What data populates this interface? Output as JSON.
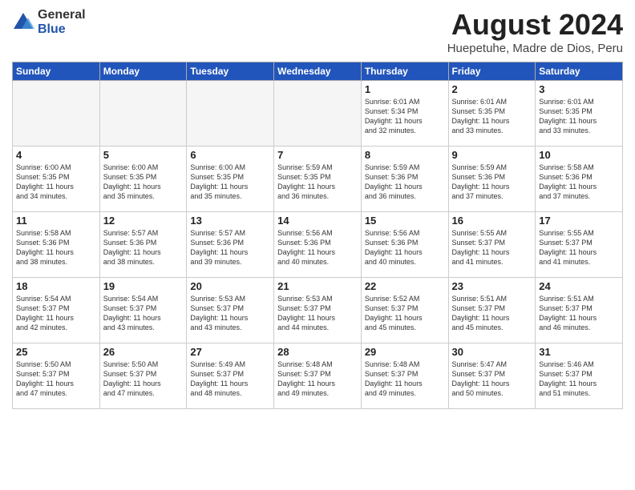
{
  "logo": {
    "general": "General",
    "blue": "Blue"
  },
  "title": "August 2024",
  "subtitle": "Huepetuhe, Madre de Dios, Peru",
  "days_header": [
    "Sunday",
    "Monday",
    "Tuesday",
    "Wednesday",
    "Thursday",
    "Friday",
    "Saturday"
  ],
  "weeks": [
    [
      {
        "day": "",
        "info": ""
      },
      {
        "day": "",
        "info": ""
      },
      {
        "day": "",
        "info": ""
      },
      {
        "day": "",
        "info": ""
      },
      {
        "day": "1",
        "info": "Sunrise: 6:01 AM\nSunset: 5:34 PM\nDaylight: 11 hours\nand 32 minutes."
      },
      {
        "day": "2",
        "info": "Sunrise: 6:01 AM\nSunset: 5:35 PM\nDaylight: 11 hours\nand 33 minutes."
      },
      {
        "day": "3",
        "info": "Sunrise: 6:01 AM\nSunset: 5:35 PM\nDaylight: 11 hours\nand 33 minutes."
      }
    ],
    [
      {
        "day": "4",
        "info": "Sunrise: 6:00 AM\nSunset: 5:35 PM\nDaylight: 11 hours\nand 34 minutes."
      },
      {
        "day": "5",
        "info": "Sunrise: 6:00 AM\nSunset: 5:35 PM\nDaylight: 11 hours\nand 35 minutes."
      },
      {
        "day": "6",
        "info": "Sunrise: 6:00 AM\nSunset: 5:35 PM\nDaylight: 11 hours\nand 35 minutes."
      },
      {
        "day": "7",
        "info": "Sunrise: 5:59 AM\nSunset: 5:35 PM\nDaylight: 11 hours\nand 36 minutes."
      },
      {
        "day": "8",
        "info": "Sunrise: 5:59 AM\nSunset: 5:36 PM\nDaylight: 11 hours\nand 36 minutes."
      },
      {
        "day": "9",
        "info": "Sunrise: 5:59 AM\nSunset: 5:36 PM\nDaylight: 11 hours\nand 37 minutes."
      },
      {
        "day": "10",
        "info": "Sunrise: 5:58 AM\nSunset: 5:36 PM\nDaylight: 11 hours\nand 37 minutes."
      }
    ],
    [
      {
        "day": "11",
        "info": "Sunrise: 5:58 AM\nSunset: 5:36 PM\nDaylight: 11 hours\nand 38 minutes."
      },
      {
        "day": "12",
        "info": "Sunrise: 5:57 AM\nSunset: 5:36 PM\nDaylight: 11 hours\nand 38 minutes."
      },
      {
        "day": "13",
        "info": "Sunrise: 5:57 AM\nSunset: 5:36 PM\nDaylight: 11 hours\nand 39 minutes."
      },
      {
        "day": "14",
        "info": "Sunrise: 5:56 AM\nSunset: 5:36 PM\nDaylight: 11 hours\nand 40 minutes."
      },
      {
        "day": "15",
        "info": "Sunrise: 5:56 AM\nSunset: 5:36 PM\nDaylight: 11 hours\nand 40 minutes."
      },
      {
        "day": "16",
        "info": "Sunrise: 5:55 AM\nSunset: 5:37 PM\nDaylight: 11 hours\nand 41 minutes."
      },
      {
        "day": "17",
        "info": "Sunrise: 5:55 AM\nSunset: 5:37 PM\nDaylight: 11 hours\nand 41 minutes."
      }
    ],
    [
      {
        "day": "18",
        "info": "Sunrise: 5:54 AM\nSunset: 5:37 PM\nDaylight: 11 hours\nand 42 minutes."
      },
      {
        "day": "19",
        "info": "Sunrise: 5:54 AM\nSunset: 5:37 PM\nDaylight: 11 hours\nand 43 minutes."
      },
      {
        "day": "20",
        "info": "Sunrise: 5:53 AM\nSunset: 5:37 PM\nDaylight: 11 hours\nand 43 minutes."
      },
      {
        "day": "21",
        "info": "Sunrise: 5:53 AM\nSunset: 5:37 PM\nDaylight: 11 hours\nand 44 minutes."
      },
      {
        "day": "22",
        "info": "Sunrise: 5:52 AM\nSunset: 5:37 PM\nDaylight: 11 hours\nand 45 minutes."
      },
      {
        "day": "23",
        "info": "Sunrise: 5:51 AM\nSunset: 5:37 PM\nDaylight: 11 hours\nand 45 minutes."
      },
      {
        "day": "24",
        "info": "Sunrise: 5:51 AM\nSunset: 5:37 PM\nDaylight: 11 hours\nand 46 minutes."
      }
    ],
    [
      {
        "day": "25",
        "info": "Sunrise: 5:50 AM\nSunset: 5:37 PM\nDaylight: 11 hours\nand 47 minutes."
      },
      {
        "day": "26",
        "info": "Sunrise: 5:50 AM\nSunset: 5:37 PM\nDaylight: 11 hours\nand 47 minutes."
      },
      {
        "day": "27",
        "info": "Sunrise: 5:49 AM\nSunset: 5:37 PM\nDaylight: 11 hours\nand 48 minutes."
      },
      {
        "day": "28",
        "info": "Sunrise: 5:48 AM\nSunset: 5:37 PM\nDaylight: 11 hours\nand 49 minutes."
      },
      {
        "day": "29",
        "info": "Sunrise: 5:48 AM\nSunset: 5:37 PM\nDaylight: 11 hours\nand 49 minutes."
      },
      {
        "day": "30",
        "info": "Sunrise: 5:47 AM\nSunset: 5:37 PM\nDaylight: 11 hours\nand 50 minutes."
      },
      {
        "day": "31",
        "info": "Sunrise: 5:46 AM\nSunset: 5:37 PM\nDaylight: 11 hours\nand 51 minutes."
      }
    ]
  ]
}
